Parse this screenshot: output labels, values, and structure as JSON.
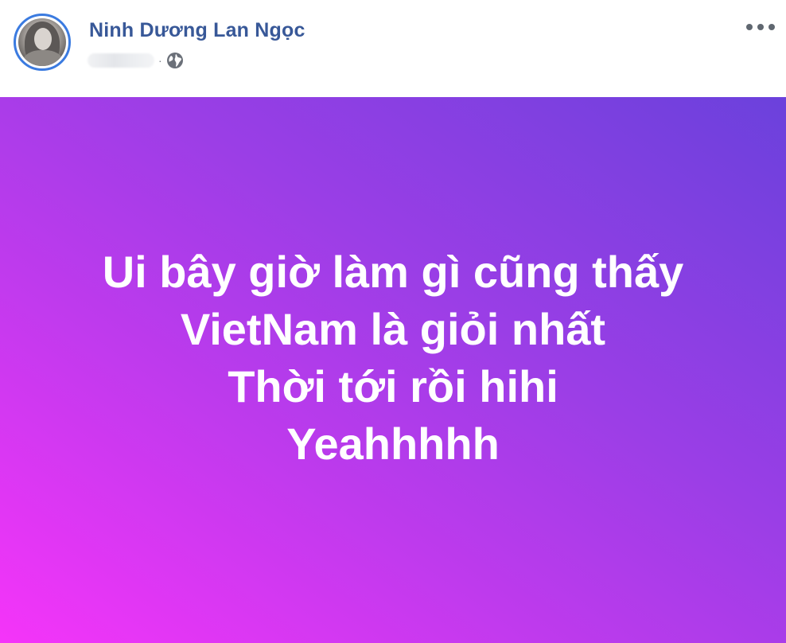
{
  "post": {
    "author_name": "Ninh Dương Lan Ngọc",
    "dot_separator": "·",
    "privacy": "globe-icon",
    "more_options": "more-icon",
    "status_lines": [
      "Ui bây giờ làm gì cũng thấy",
      "VietNam là giỏi nhất",
      "Thời tới rồi hihi",
      "Yeahhhhh"
    ]
  },
  "colors": {
    "author_name": "#385898",
    "avatar_ring": "#3b7be0",
    "banner_gradient_start": "#f534f9",
    "banner_gradient_end": "#6b41dc",
    "status_text": "#ffffff",
    "icon_gray": "#606770"
  }
}
